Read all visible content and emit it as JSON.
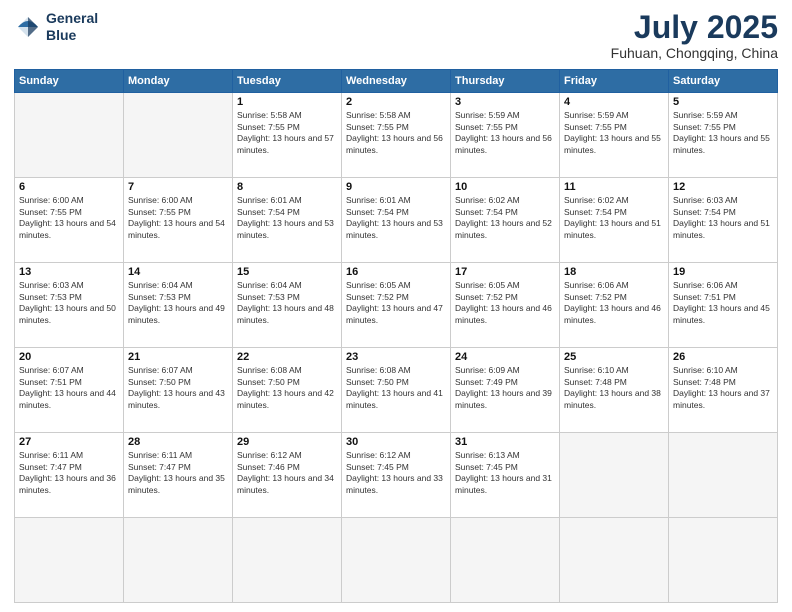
{
  "logo": {
    "line1": "General",
    "line2": "Blue"
  },
  "title": {
    "month_year": "July 2025",
    "location": "Fuhuan, Chongqing, China"
  },
  "weekdays": [
    "Sunday",
    "Monday",
    "Tuesday",
    "Wednesday",
    "Thursday",
    "Friday",
    "Saturday"
  ],
  "days": [
    {
      "num": "",
      "detail": ""
    },
    {
      "num": "",
      "detail": ""
    },
    {
      "num": "1",
      "sunrise": "5:58 AM",
      "sunset": "7:55 PM",
      "daylight": "13 hours and 57 minutes."
    },
    {
      "num": "2",
      "sunrise": "5:58 AM",
      "sunset": "7:55 PM",
      "daylight": "13 hours and 56 minutes."
    },
    {
      "num": "3",
      "sunrise": "5:59 AM",
      "sunset": "7:55 PM",
      "daylight": "13 hours and 56 minutes."
    },
    {
      "num": "4",
      "sunrise": "5:59 AM",
      "sunset": "7:55 PM",
      "daylight": "13 hours and 55 minutes."
    },
    {
      "num": "5",
      "sunrise": "5:59 AM",
      "sunset": "7:55 PM",
      "daylight": "13 hours and 55 minutes."
    },
    {
      "num": "6",
      "sunrise": "6:00 AM",
      "sunset": "7:55 PM",
      "daylight": "13 hours and 54 minutes."
    },
    {
      "num": "7",
      "sunrise": "6:00 AM",
      "sunset": "7:55 PM",
      "daylight": "13 hours and 54 minutes."
    },
    {
      "num": "8",
      "sunrise": "6:01 AM",
      "sunset": "7:54 PM",
      "daylight": "13 hours and 53 minutes."
    },
    {
      "num": "9",
      "sunrise": "6:01 AM",
      "sunset": "7:54 PM",
      "daylight": "13 hours and 53 minutes."
    },
    {
      "num": "10",
      "sunrise": "6:02 AM",
      "sunset": "7:54 PM",
      "daylight": "13 hours and 52 minutes."
    },
    {
      "num": "11",
      "sunrise": "6:02 AM",
      "sunset": "7:54 PM",
      "daylight": "13 hours and 51 minutes."
    },
    {
      "num": "12",
      "sunrise": "6:03 AM",
      "sunset": "7:54 PM",
      "daylight": "13 hours and 51 minutes."
    },
    {
      "num": "13",
      "sunrise": "6:03 AM",
      "sunset": "7:53 PM",
      "daylight": "13 hours and 50 minutes."
    },
    {
      "num": "14",
      "sunrise": "6:04 AM",
      "sunset": "7:53 PM",
      "daylight": "13 hours and 49 minutes."
    },
    {
      "num": "15",
      "sunrise": "6:04 AM",
      "sunset": "7:53 PM",
      "daylight": "13 hours and 48 minutes."
    },
    {
      "num": "16",
      "sunrise": "6:05 AM",
      "sunset": "7:52 PM",
      "daylight": "13 hours and 47 minutes."
    },
    {
      "num": "17",
      "sunrise": "6:05 AM",
      "sunset": "7:52 PM",
      "daylight": "13 hours and 46 minutes."
    },
    {
      "num": "18",
      "sunrise": "6:06 AM",
      "sunset": "7:52 PM",
      "daylight": "13 hours and 46 minutes."
    },
    {
      "num": "19",
      "sunrise": "6:06 AM",
      "sunset": "7:51 PM",
      "daylight": "13 hours and 45 minutes."
    },
    {
      "num": "20",
      "sunrise": "6:07 AM",
      "sunset": "7:51 PM",
      "daylight": "13 hours and 44 minutes."
    },
    {
      "num": "21",
      "sunrise": "6:07 AM",
      "sunset": "7:50 PM",
      "daylight": "13 hours and 43 minutes."
    },
    {
      "num": "22",
      "sunrise": "6:08 AM",
      "sunset": "7:50 PM",
      "daylight": "13 hours and 42 minutes."
    },
    {
      "num": "23",
      "sunrise": "6:08 AM",
      "sunset": "7:50 PM",
      "daylight": "13 hours and 41 minutes."
    },
    {
      "num": "24",
      "sunrise": "6:09 AM",
      "sunset": "7:49 PM",
      "daylight": "13 hours and 39 minutes."
    },
    {
      "num": "25",
      "sunrise": "6:10 AM",
      "sunset": "7:48 PM",
      "daylight": "13 hours and 38 minutes."
    },
    {
      "num": "26",
      "sunrise": "6:10 AM",
      "sunset": "7:48 PM",
      "daylight": "13 hours and 37 minutes."
    },
    {
      "num": "27",
      "sunrise": "6:11 AM",
      "sunset": "7:47 PM",
      "daylight": "13 hours and 36 minutes."
    },
    {
      "num": "28",
      "sunrise": "6:11 AM",
      "sunset": "7:47 PM",
      "daylight": "13 hours and 35 minutes."
    },
    {
      "num": "29",
      "sunrise": "6:12 AM",
      "sunset": "7:46 PM",
      "daylight": "13 hours and 34 minutes."
    },
    {
      "num": "30",
      "sunrise": "6:12 AM",
      "sunset": "7:45 PM",
      "daylight": "13 hours and 33 minutes."
    },
    {
      "num": "31",
      "sunrise": "6:13 AM",
      "sunset": "7:45 PM",
      "daylight": "13 hours and 31 minutes."
    }
  ]
}
